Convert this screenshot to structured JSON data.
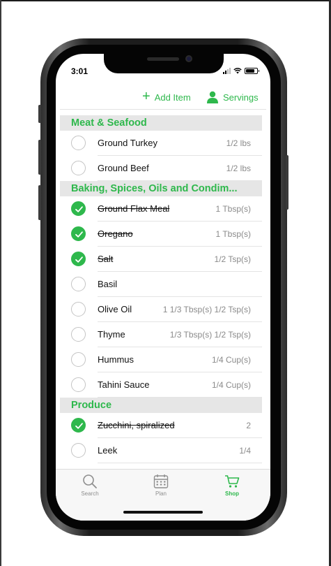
{
  "status": {
    "time": "3:01"
  },
  "toolbar": {
    "add_item": "Add Item",
    "servings": "Servings"
  },
  "accent_color": "#2eb84c",
  "sections": [
    {
      "title": "Meat & Seafood",
      "items": [
        {
          "name": "Ground Turkey",
          "qty": "1/2 lbs",
          "checked": false
        },
        {
          "name": "Ground Beef",
          "qty": "1/2 lbs",
          "checked": false
        }
      ]
    },
    {
      "title": "Baking, Spices, Oils and Condim...",
      "items": [
        {
          "name": "Ground Flax Meal",
          "qty": "1 Tbsp(s)",
          "checked": true
        },
        {
          "name": "Oregano",
          "qty": "1 Tbsp(s)",
          "checked": true
        },
        {
          "name": "Salt",
          "qty": "1/2 Tsp(s)",
          "checked": true
        },
        {
          "name": "Basil",
          "qty": "",
          "checked": false
        },
        {
          "name": "Olive Oil",
          "qty": "1 1/3 Tbsp(s) 1/2 Tsp(s)",
          "checked": false
        },
        {
          "name": "Thyme",
          "qty": "1/3 Tbsp(s) 1/2 Tsp(s)",
          "checked": false
        },
        {
          "name": "Hummus",
          "qty": "1/4 Cup(s)",
          "checked": false
        },
        {
          "name": "Tahini Sauce",
          "qty": "1/4 Cup(s)",
          "checked": false
        }
      ]
    },
    {
      "title": "Produce",
      "items": [
        {
          "name": "Zucchini, spiralized",
          "qty": "2",
          "checked": true
        },
        {
          "name": "Leek",
          "qty": "1/4",
          "checked": false
        }
      ]
    }
  ],
  "tabs": [
    {
      "label": "Search",
      "icon": "search-icon",
      "active": false
    },
    {
      "label": "Plan",
      "icon": "calendar-icon",
      "active": false
    },
    {
      "label": "Shop",
      "icon": "cart-icon",
      "active": true
    }
  ]
}
